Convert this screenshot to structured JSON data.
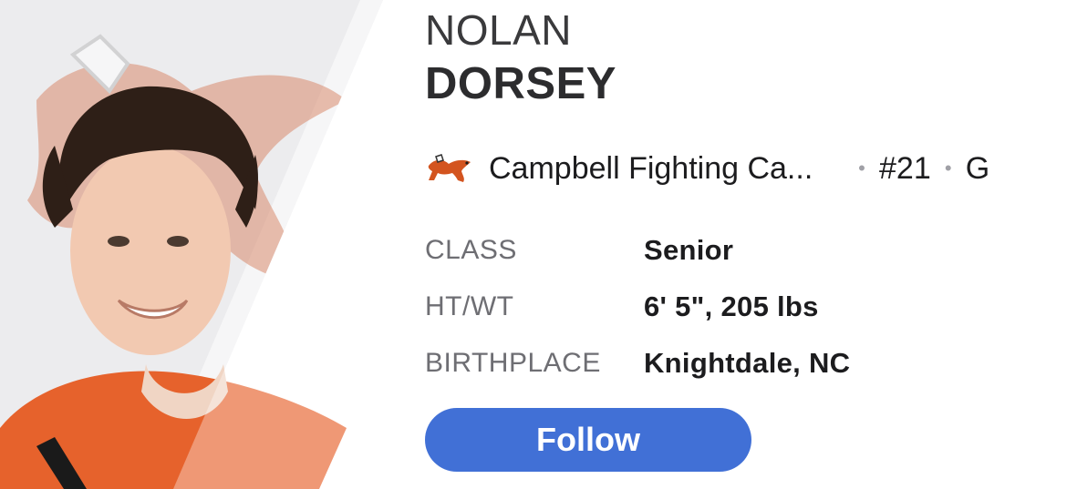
{
  "player": {
    "first_name": "NOLAN",
    "last_name": "DORSEY"
  },
  "team": {
    "name": "Campbell Fighting Ca...",
    "logo_icon": "camel-icon",
    "jersey": "#21",
    "position": "G",
    "separator": "•"
  },
  "stats": [
    {
      "label": "CLASS",
      "value": "Senior"
    },
    {
      "label": "HT/WT",
      "value": "6' 5\", 205 lbs"
    },
    {
      "label": "BIRTHPLACE",
      "value": "Knightdale, NC"
    }
  ],
  "follow_button": {
    "label": "Follow"
  },
  "colors": {
    "accent": "#4170d6",
    "team_orange": "#e8632a",
    "label_gray": "#6e6e73"
  }
}
